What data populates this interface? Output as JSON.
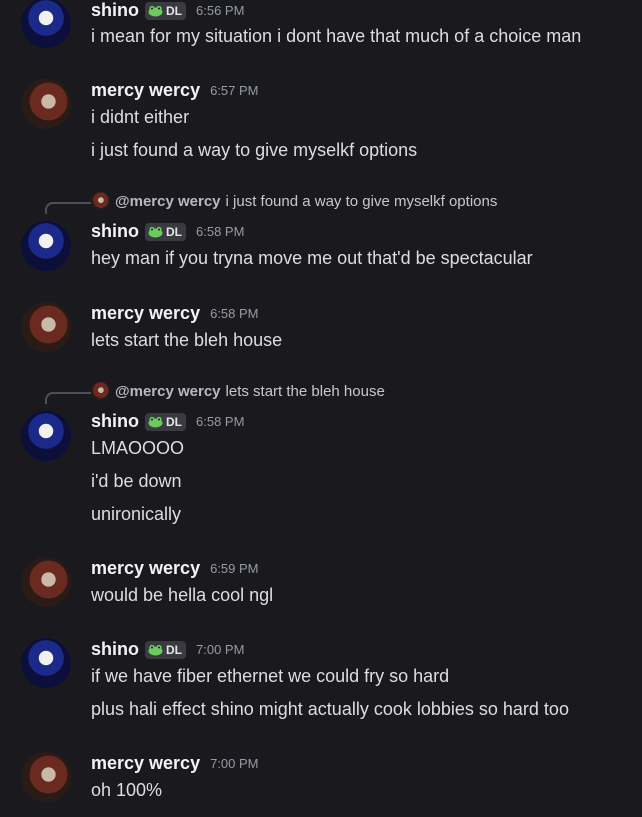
{
  "messages": [
    {
      "username": "shino",
      "badge": "DL",
      "time": "6:56 PM",
      "lines": [
        "i mean for my situation i dont have that much of a choice man"
      ]
    },
    {
      "username": "mercy wercy",
      "time": "6:57 PM",
      "lines": [
        "i didnt either",
        "i just found a way to give myselkf options"
      ]
    },
    {
      "reply": {
        "name": "@mercy wercy",
        "text": "i just found a way to give myselkf options"
      },
      "username": "shino",
      "badge": "DL",
      "time": "6:58 PM",
      "lines": [
        "hey man if you tryna move me out that'd be spectacular"
      ]
    },
    {
      "username": "mercy wercy",
      "time": "6:58 PM",
      "lines": [
        "lets start the bleh house"
      ]
    },
    {
      "reply": {
        "name": "@mercy wercy",
        "text": "lets start the bleh house"
      },
      "username": "shino",
      "badge": "DL",
      "time": "6:58 PM",
      "lines": [
        "LMAOOOO",
        "i'd be down",
        "unironically"
      ]
    },
    {
      "username": "mercy wercy",
      "time": "6:59 PM",
      "lines": [
        "would be hella cool ngl"
      ]
    },
    {
      "username": "shino",
      "badge": "DL",
      "time": "7:00 PM",
      "lines": [
        "if we have fiber ethernet we could fry so hard",
        "plus hali effect shino might actually cook lobbies so hard too"
      ]
    },
    {
      "username": "mercy wercy",
      "time": "7:00 PM",
      "lines": [
        "oh 100%"
      ]
    }
  ]
}
